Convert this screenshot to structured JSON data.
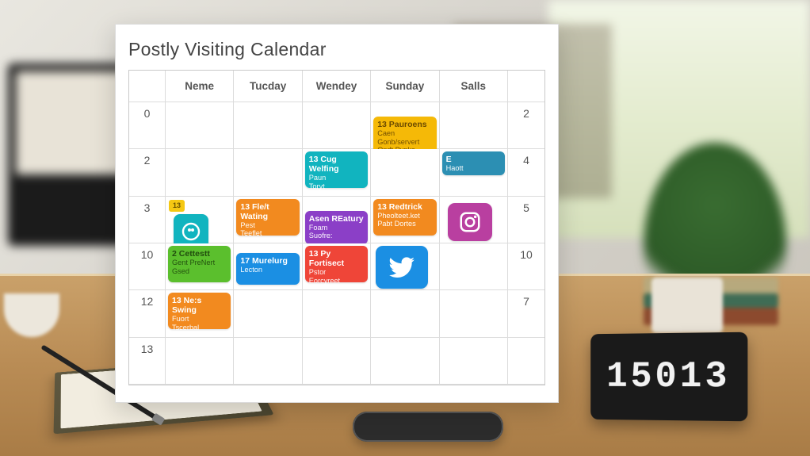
{
  "clock": {
    "time": "15013"
  },
  "calendar": {
    "title": "Postly Visiting Calendar",
    "columns": [
      "Neme",
      "Tucday",
      "Wendey",
      "Sunday",
      "Salls"
    ],
    "row_left": [
      "0",
      "2",
      "3",
      "10",
      "12",
      "13"
    ],
    "row_right": [
      "2",
      "4",
      "5",
      "10",
      "7",
      ""
    ],
    "events": {
      "e1": {
        "num": "13",
        "title": "Pauroens",
        "sub1": "Caen",
        "sub2": "Gonb/servert",
        "sub3": "Ondt Pypks"
      },
      "e2": {
        "num": "E",
        "title": "Haott"
      },
      "e3": {
        "num": "13",
        "title": "Cug Welfing",
        "sub1": "Paun",
        "sub2": "Toryt"
      },
      "e4": {
        "num": "13",
        "title": "Fle/t Wating",
        "sub1": "Pest",
        "sub2": "Teeflet"
      },
      "e5": {
        "num": "13",
        "title": "Redtrick",
        "sub1": "Pheolteet.ket",
        "sub2": "Pabt Dortes"
      },
      "e6": {
        "title": "Asen REatury",
        "sub1": "Foam",
        "sub2": "Suofre:"
      },
      "e7": {
        "num": "2",
        "title": "Cettestt",
        "sub1": "Gent PreNert",
        "sub2": "Gsed"
      },
      "e8": {
        "num": "17",
        "title": "Murelurg",
        "sub1": "Lecton"
      },
      "e9": {
        "num": "13",
        "title": "Py Fortisect",
        "sub1": "Pstor",
        "sub2": "Eorcyreet"
      },
      "e10": {
        "num": "13",
        "title": "Ne:s Swing",
        "sub1": "Fuort",
        "sub2": "Tscerbal"
      },
      "badge_r2c1": "13"
    },
    "icons": {
      "row2_col1": "info-circle-icon",
      "row3_col5": "instagram-icon",
      "row4_col4": "twitter-icon"
    }
  }
}
